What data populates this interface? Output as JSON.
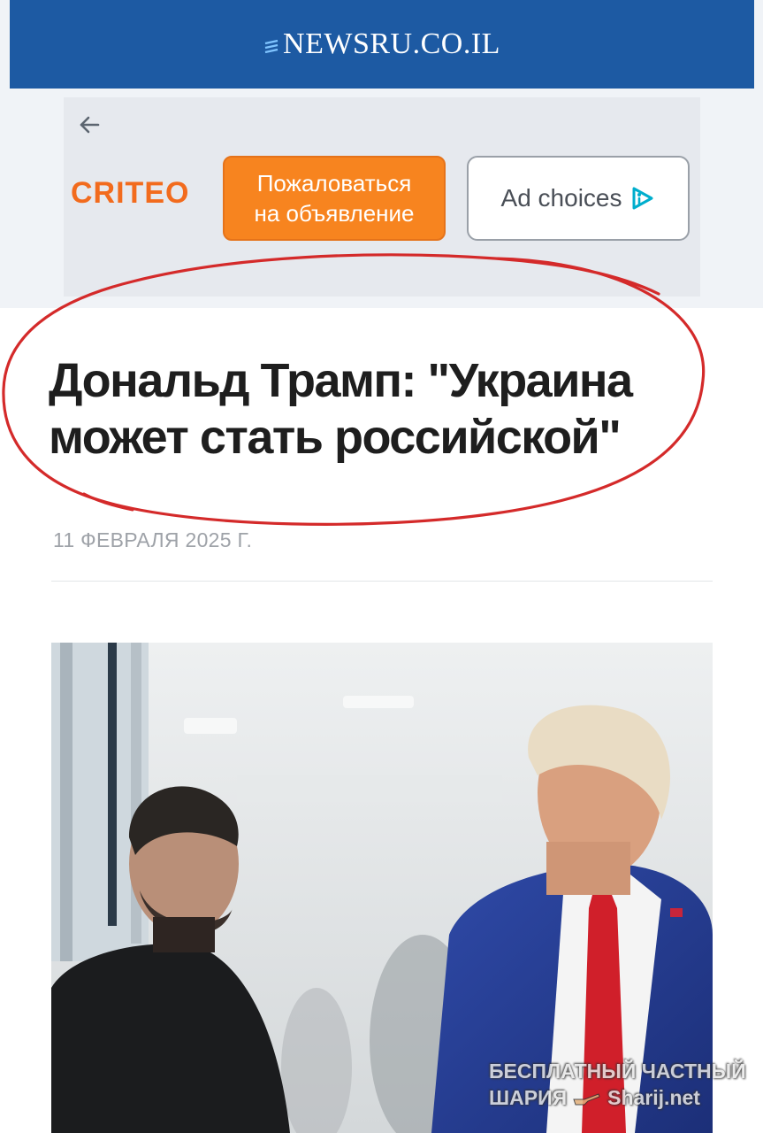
{
  "header": {
    "logo_text": "NEWSRU.CO.IL",
    "background_color": "#1d5aa3"
  },
  "ad": {
    "back_icon": "arrow-left-icon",
    "brand": "CRITEO",
    "brand_color": "#f26b1d",
    "report_line1": "Пожаловаться",
    "report_line2": "на объявление",
    "report_color": "#f7841f",
    "adchoices_label": "Ad choices",
    "adchoices_icon": "adchoices-icon"
  },
  "article": {
    "title_line1": "Дональд Трамп: \"Украина",
    "title_line2": "может стать российской\"",
    "date": "11 ФЕВРАЛЯ 2025 Г.",
    "annotation_color": "#d42a2a"
  },
  "photo": {
    "watermark_line1": "БЕСПЛАТНЫЙ ЧАСТНЫЙ",
    "watermark_line2a": "ШАРИЯ",
    "watermark_line2b": "Sharij.net",
    "watermark_icon": "pointing-hand-icon"
  }
}
